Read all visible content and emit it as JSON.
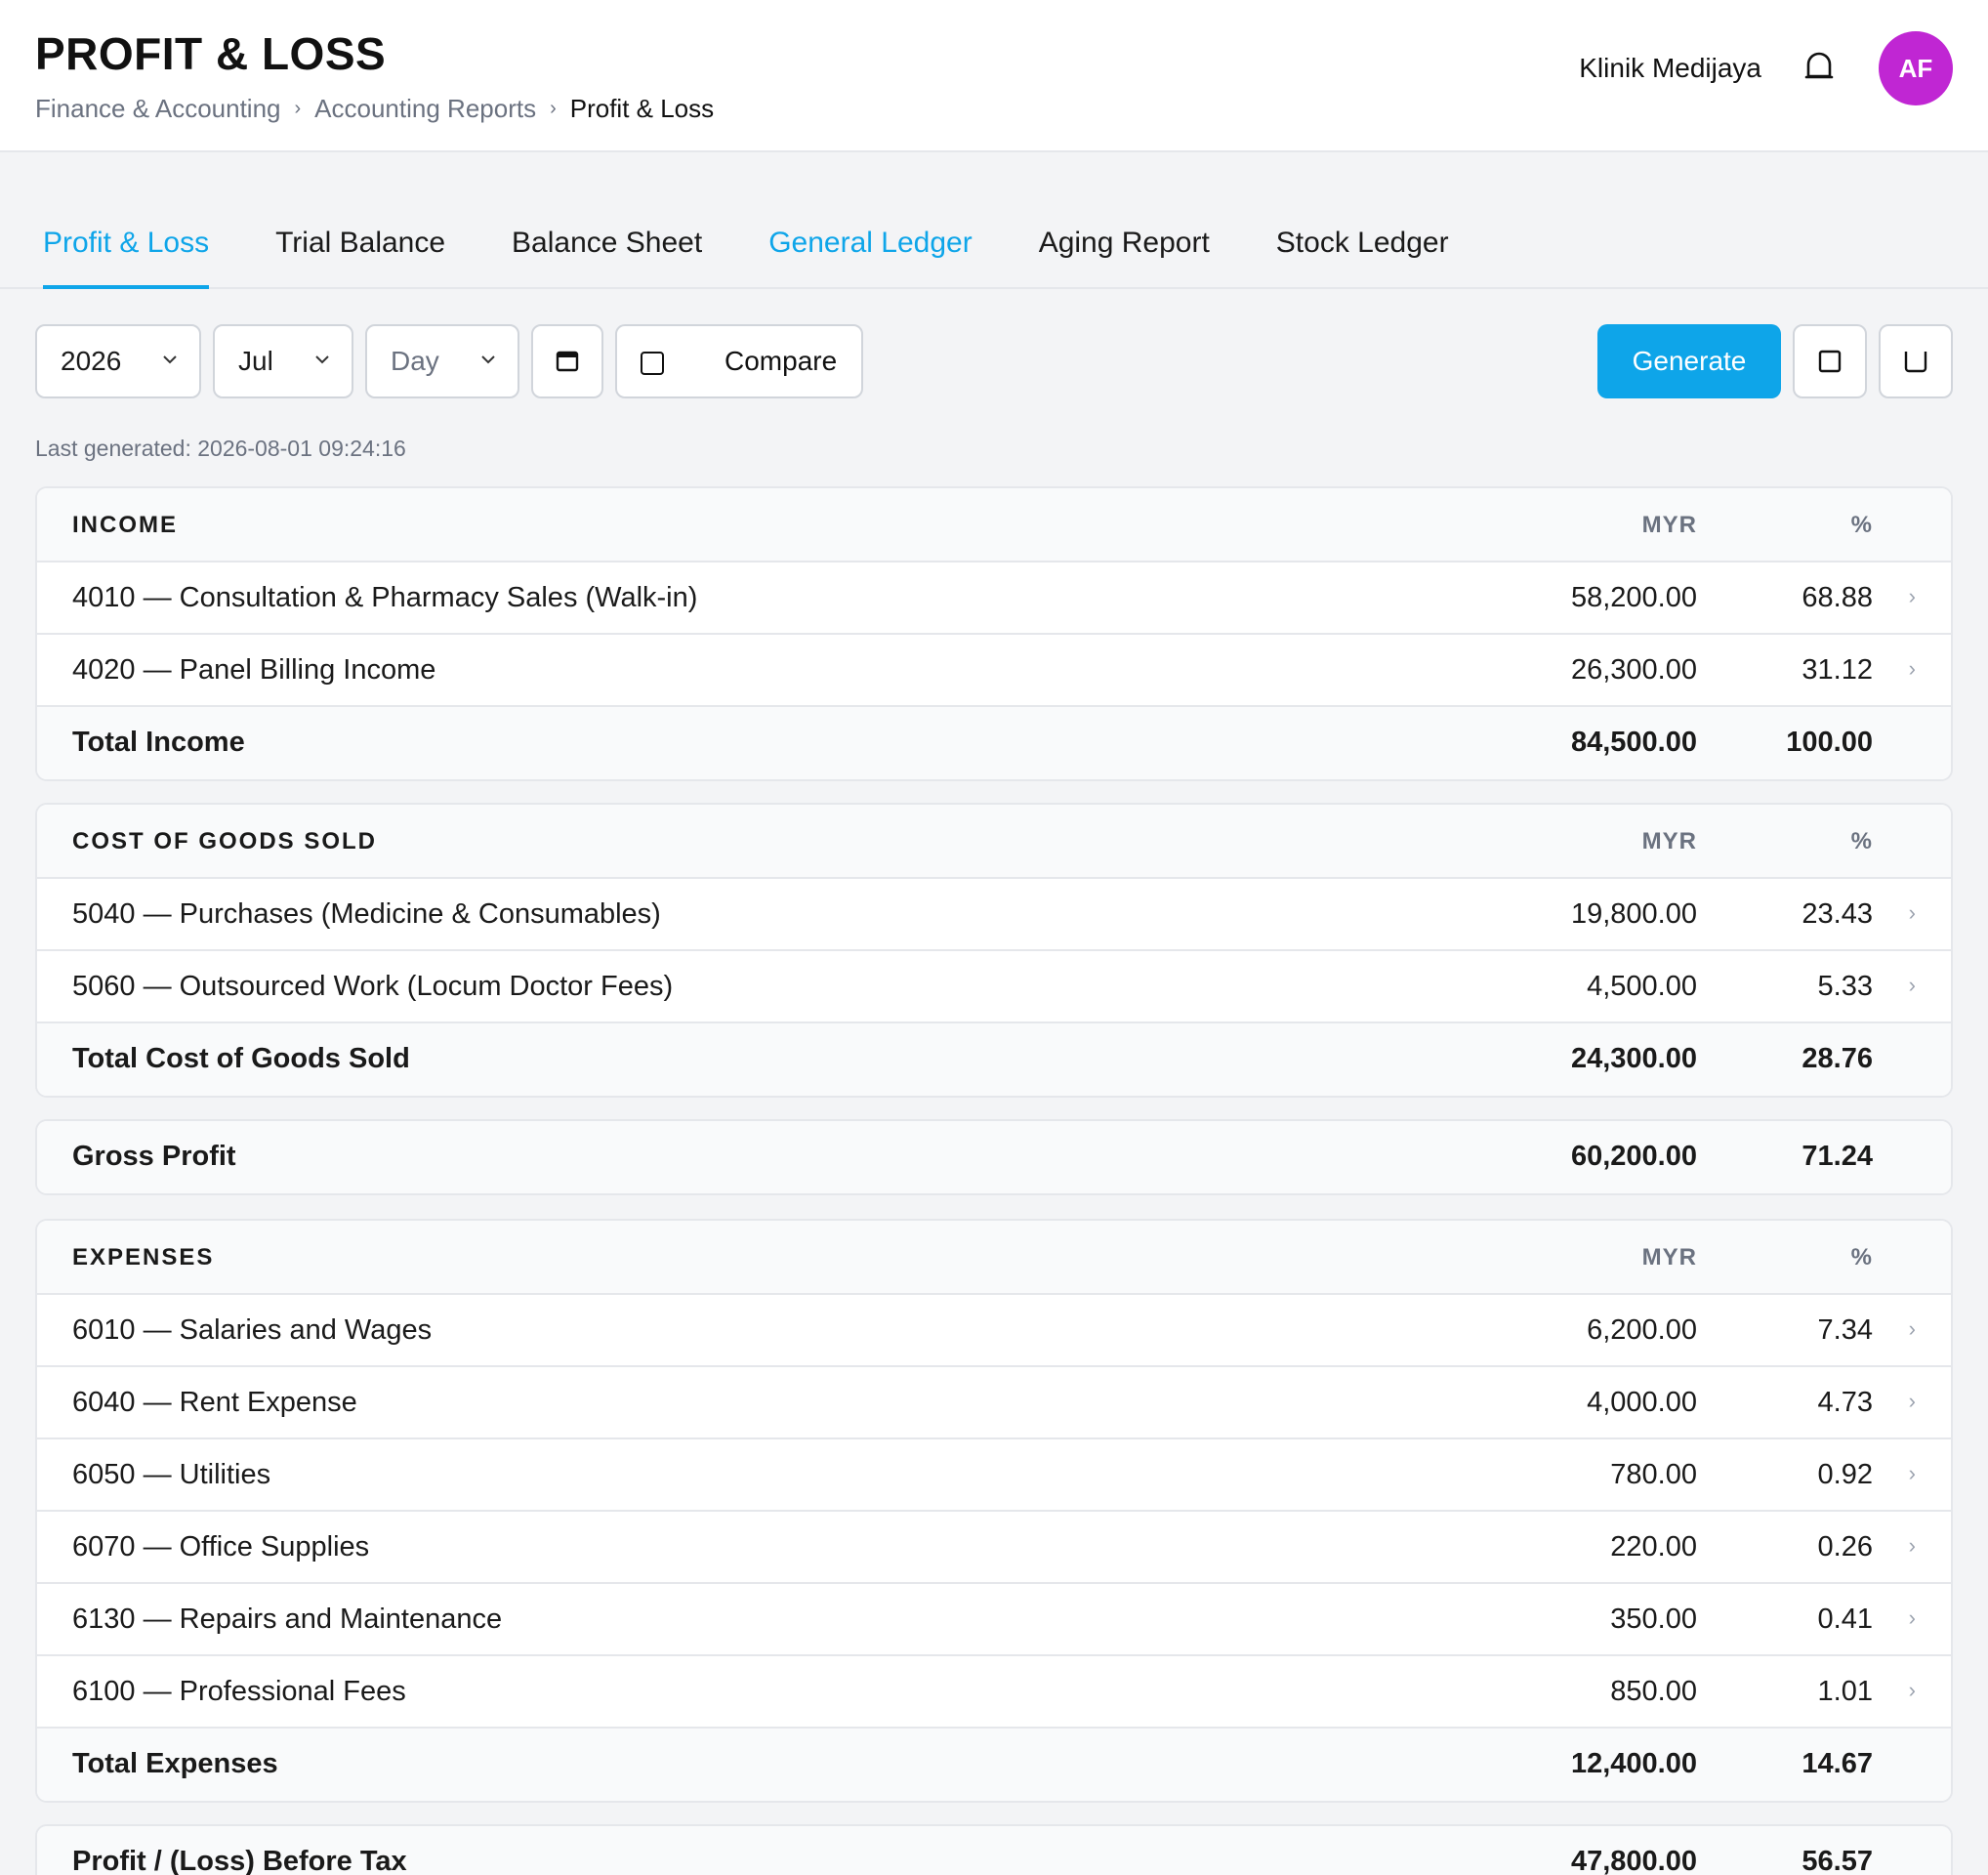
{
  "header": {
    "title": "PROFIT & LOSS",
    "breadcrumb": [
      "Finance & Accounting",
      "Accounting Reports",
      "Profit & Loss"
    ],
    "clinic_name": "Klinik Medijaya",
    "avatar_initials": "AF",
    "avatar_color": "#c026d3"
  },
  "tabs": [
    {
      "label": "Profit & Loss",
      "state": "active"
    },
    {
      "label": "Trial Balance",
      "state": "normal"
    },
    {
      "label": "Balance Sheet",
      "state": "normal"
    },
    {
      "label": "General Ledger",
      "state": "link"
    },
    {
      "label": "Aging Report",
      "state": "normal"
    },
    {
      "label": "Stock Ledger",
      "state": "normal"
    }
  ],
  "toolbar": {
    "year": "2026",
    "month": "Jul",
    "day_placeholder": "Day",
    "compare_label": "Compare",
    "generate_label": "Generate",
    "accent_color": "#0ea5e9"
  },
  "last_generated": "Last generated: 2026-08-01 09:24:16",
  "income": {
    "title": "INCOME",
    "col_amount": "MYR",
    "col_pct": "%",
    "rows": [
      {
        "label": "4010 — Consultation & Pharmacy Sales (Walk-in)",
        "amount": "58,200.00",
        "pct": "68.88"
      },
      {
        "label": "4020 — Panel Billing Income",
        "amount": "26,300.00",
        "pct": "31.12"
      }
    ],
    "total": {
      "label": "Total Income",
      "amount": "84,500.00",
      "pct": "100.00"
    }
  },
  "cogs": {
    "title": "COST OF GOODS SOLD",
    "col_amount": "MYR",
    "col_pct": "%",
    "rows": [
      {
        "label": "5040 — Purchases (Medicine & Consumables)",
        "amount": "19,800.00",
        "pct": "23.43"
      },
      {
        "label": "5060 — Outsourced Work (Locum Doctor Fees)",
        "amount": "4,500.00",
        "pct": "5.33"
      }
    ],
    "total": {
      "label": "Total Cost of Goods Sold",
      "amount": "24,300.00",
      "pct": "28.76"
    }
  },
  "gross_profit": {
    "label": "Gross Profit",
    "amount": "60,200.00",
    "pct": "71.24"
  },
  "expenses": {
    "title": "EXPENSES",
    "col_amount": "MYR",
    "col_pct": "%",
    "rows": [
      {
        "label": "6010 — Salaries and Wages",
        "amount": "6,200.00",
        "pct": "7.34"
      },
      {
        "label": "6040 — Rent Expense",
        "amount": "4,000.00",
        "pct": "4.73"
      },
      {
        "label": "6050 — Utilities",
        "amount": "780.00",
        "pct": "0.92"
      },
      {
        "label": "6070 — Office Supplies",
        "amount": "220.00",
        "pct": "0.26"
      },
      {
        "label": "6130 — Repairs and Maintenance",
        "amount": "350.00",
        "pct": "0.41"
      },
      {
        "label": "6100 — Professional Fees",
        "amount": "850.00",
        "pct": "1.01"
      }
    ],
    "total": {
      "label": "Total Expenses",
      "amount": "12,400.00",
      "pct": "14.67"
    }
  },
  "profit_before_tax": {
    "label": "Profit / (Loss) Before Tax",
    "amount": "47,800.00",
    "pct": "56.57"
  }
}
